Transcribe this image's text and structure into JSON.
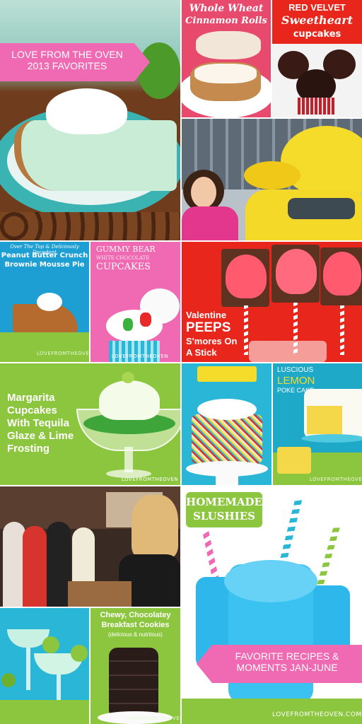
{
  "banner_top": {
    "line1": "LOVE FROM THE OVEN",
    "line2": "2013 FAVORITES"
  },
  "tile_cinnamon": {
    "line1": "Whole Wheat",
    "line2": "Cinnamon Rolls"
  },
  "tile_redvelvet": {
    "line1": "RED VELVET",
    "line2": "Sweetheart",
    "line3": "cupcakes"
  },
  "tile_pbcrunch": {
    "line1": "Over The Top & Deliciously Decadent",
    "line2": "Peanut Butter Crunch",
    "line3": "Brownie Mousse Pie",
    "watermark": "LOVEFROMTHEOVEN"
  },
  "tile_gummy": {
    "line1": "GUMMY BEAR",
    "line2": "WHITE CHOCOLATE",
    "line3": "CUPCAKES",
    "watermark": "LOVEFROMTHEOVEN"
  },
  "tile_peeps": {
    "line1": "Valentine",
    "line2": "PEEPS",
    "line3": "S'mores On",
    "line4": "A Stick"
  },
  "tile_margarita": {
    "line1": "Margarita",
    "line2": "Cupcakes",
    "line3": "With Tequila",
    "line4": "Glaze & Lime",
    "line5": "Frosting",
    "watermark": "LOVEFROMTHEOVEN"
  },
  "tile_lemon": {
    "line1": "LUSCIOUS",
    "line2": "LEMON",
    "line3": "POKE CAKE",
    "watermark": "LOVEFROMTHEOVEN"
  },
  "tile_slushies": {
    "line1": "HOMEMADE",
    "line2": "SLUSHIES"
  },
  "tile_cookies": {
    "line1": "Chewy, Chocolatey",
    "line2": "Breakfast Cookies",
    "line3": "(delicious & nutritous)",
    "watermark": "LOVEFROMTHEOVEN"
  },
  "banner_bottom": {
    "line1": "FAVORITE RECIPES &",
    "line2": "MOMENTS JAN-JUNE"
  },
  "watermark_main": "LOVEFROMTHEOVEN.COM",
  "colors": {
    "pink": "#f06ab3",
    "lime": "#8cc63f",
    "aqua": "#2ab6d6",
    "red": "#e82a2a"
  }
}
